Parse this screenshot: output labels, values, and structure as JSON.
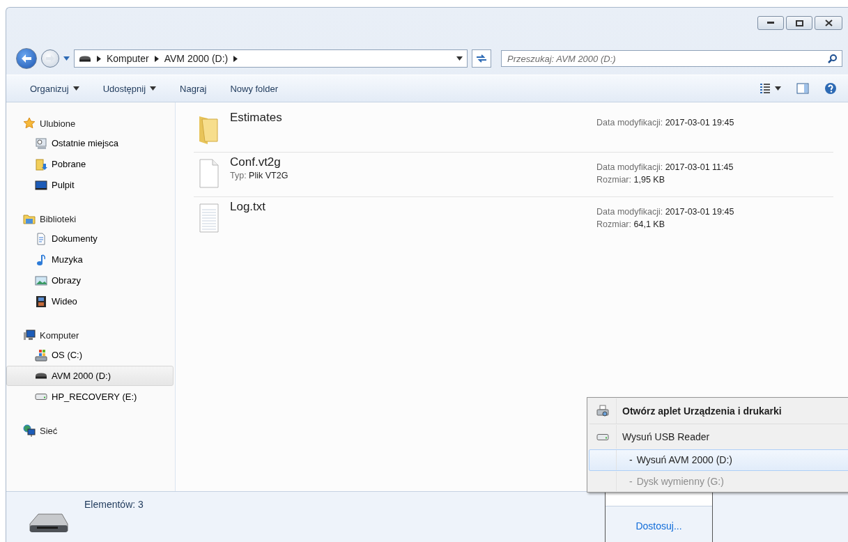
{
  "address": {
    "crumbs": [
      "Komputer",
      "AVM 2000 (D:)"
    ]
  },
  "search": {
    "placeholder": "Przeszukaj: AVM 2000 (D:)"
  },
  "toolbar": [
    {
      "label": "Organizuj",
      "dropdown": true
    },
    {
      "label": "Udostępnij",
      "dropdown": true
    },
    {
      "label": "Nagraj",
      "dropdown": false
    },
    {
      "label": "Nowy folder",
      "dropdown": false
    }
  ],
  "sidebar": {
    "groups": [
      {
        "label": "Ulubione",
        "kind": "star",
        "items": [
          {
            "label": "Ostatnie miejsca",
            "kind": "recent",
            "selected": false
          },
          {
            "label": "Pobrane",
            "kind": "download",
            "selected": false
          },
          {
            "label": "Pulpit",
            "kind": "desktop",
            "selected": false
          }
        ]
      },
      {
        "label": "Biblioteki",
        "kind": "library",
        "items": [
          {
            "label": "Dokumenty",
            "kind": "document",
            "selected": false
          },
          {
            "label": "Muzyka",
            "kind": "music",
            "selected": false
          },
          {
            "label": "Obrazy",
            "kind": "image",
            "selected": false
          },
          {
            "label": "Wideo",
            "kind": "video",
            "selected": false
          }
        ]
      },
      {
        "label": "Komputer",
        "kind": "computer",
        "items": [
          {
            "label": "OS (C:)",
            "kind": "osdrive",
            "selected": false
          },
          {
            "label": "AVM 2000 (D:)",
            "kind": "card",
            "selected": true
          },
          {
            "label": "HP_RECOVERY (E:)",
            "kind": "drive",
            "selected": false
          }
        ]
      },
      {
        "label": "Sieć",
        "kind": "network"
      }
    ]
  },
  "files": [
    {
      "name": "Estimates",
      "kind": "folder",
      "details": [
        {
          "label": "Data modyfikacji:",
          "value": "2017-03-01 19:45"
        }
      ]
    },
    {
      "name": "Conf.vt2g",
      "kind": "blank",
      "info": [
        {
          "label": "Typ:",
          "value": "Plik VT2G"
        }
      ],
      "details": [
        {
          "label": "Data modyfikacji:",
          "value": "2017-03-01 11:45"
        },
        {
          "label": "Rozmiar:",
          "value": "1,95 KB"
        }
      ]
    },
    {
      "name": "Log.txt",
      "kind": "text",
      "details": [
        {
          "label": "Data modyfikacji:",
          "value": "2017-03-01 19:45"
        },
        {
          "label": "Rozmiar:",
          "value": "64,1 KB"
        }
      ]
    }
  ],
  "status": {
    "count": "Elementów: 3"
  },
  "menu": {
    "items": [
      {
        "kind": "header",
        "label": "Otwórz aplet Urządzenia i drukarki"
      },
      {
        "kind": "device",
        "label": "Wysuń USB Reader"
      },
      {
        "kind": "volume",
        "bullet": "-",
        "label": "Wysuń AVM 2000 (D:)",
        "selected": true,
        "disabled": false
      },
      {
        "kind": "volume",
        "bullet": "-",
        "label": "Dysk wymienny (G:)",
        "selected": false,
        "disabled": true
      }
    ]
  },
  "tray": {
    "link": "Dostosuj..."
  }
}
